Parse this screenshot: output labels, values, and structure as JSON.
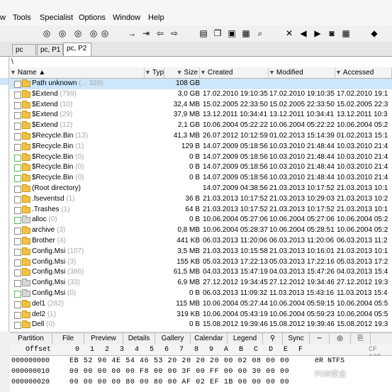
{
  "menu": [
    "w",
    "Tools",
    "Specialist",
    "Options",
    "Window",
    "Help"
  ],
  "toolbar_icons": [
    "binoculars-icon",
    "binoculars-text-icon",
    "binoculars-hex-icon",
    "binoculars-replace-icon",
    "binoculars-find-icon",
    "arrow-right-icon",
    "go-to-icon",
    "back-icon",
    "forward-icon",
    "disk-icon",
    "copy-icon",
    "image-icon",
    "calculator-icon",
    "search-icon",
    "tools-icon",
    "prev-icon",
    "next-icon",
    "camera-icon",
    "grid-icon",
    "book-icon"
  ],
  "tabs": [
    "pc",
    "pc, P1",
    "pc, P2"
  ],
  "path": "\\",
  "columns": {
    "name": "Name",
    "type": "Typ",
    "size": "Size",
    "created": "Created",
    "modified": "Modified",
    "accessed": "Accessed"
  },
  "rows": [
    {
      "name": "Path unknown",
      "count": "(... 328)",
      "size": "108 GB",
      "c": "",
      "m": "",
      "a": "",
      "icon": "folder",
      "sel": true
    },
    {
      "name": "$Extend",
      "count": "(799)",
      "size": "3,0 GB",
      "c": "17.02.2010  19:10:35",
      "m": "17.02.2010  19:10:35",
      "a": "17.02.2010  19:1",
      "icon": "folder",
      "sel": false
    },
    {
      "name": "$Extend",
      "count": "(10)",
      "size": "32,4 MB",
      "c": "15.02.2005  22:33:50",
      "m": "15.02.2005  22:33:50",
      "a": "15.02.2005  22:3",
      "icon": "folder",
      "sel": false
    },
    {
      "name": "$Extend",
      "count": "(29)",
      "size": "37,9 MB",
      "c": "13.12.2011  10:34:41",
      "m": "13.12.2011  10:34:41",
      "a": "13.12.2011  10:3",
      "icon": "folder",
      "sel": false
    },
    {
      "name": "$Extend",
      "count": "(12)",
      "size": "2,1 GB",
      "c": "10.06.2004  05:22:22",
      "m": "10.06.2004  05:22:22",
      "a": "10.06.2004  05:2",
      "icon": "folder",
      "sel": false
    },
    {
      "name": "$Recycle.Bin",
      "count": "(13)",
      "size": "41,3 MB",
      "c": "26.07.2012  10:12:59",
      "m": "01.02.2013  15:14:39",
      "a": "01.02.2013  15:1",
      "icon": "folder",
      "sel": false
    },
    {
      "name": "$Recycle.Bin",
      "count": "(1)",
      "size": "129 B",
      "c": "14.07.2009  05:18:56",
      "m": "10.03.2010  21:48:44",
      "a": "10.03.2010  21:4",
      "icon": "folder",
      "sel": false
    },
    {
      "name": "$Recycle.Bin",
      "count": "(0)",
      "size": "0 B",
      "c": "14.07.2009  05:18:56",
      "m": "10.03.2010  21:48:44",
      "a": "10.03.2010  21:4",
      "icon": "folder",
      "sel": false,
      "green": true
    },
    {
      "name": "$Recycle.Bin",
      "count": "(0)",
      "size": "0 B",
      "c": "14.07.2009  05:18:56",
      "m": "10.03.2010  21:48:44",
      "a": "10.03.2010  21:4",
      "icon": "folder",
      "sel": false,
      "green": true
    },
    {
      "name": "$Recycle.Bin",
      "count": "(0)",
      "size": "0 B",
      "c": "14.07.2009  05:18:56",
      "m": "10.03.2010  21:48:44",
      "a": "10.03.2010  21:4",
      "icon": "folder",
      "sel": false,
      "green": true
    },
    {
      "name": "(Root directory)",
      "count": "",
      "size": "",
      "c": "14.07.2009  04:38:56",
      "m": "21.03.2013  10:17:52",
      "a": "21.03.2013  10:1",
      "icon": "folder",
      "sel": false
    },
    {
      "name": ".fseventsd",
      "count": "(1)",
      "size": "36 B",
      "c": "21.03.2013  10:17:52",
      "m": "21.03.2013  10:29:03",
      "a": "21.03.2013  10:2",
      "icon": "folder",
      "sel": false
    },
    {
      "name": ".Trashes",
      "count": "(1)",
      "size": "64 B",
      "c": "21.03.2013  10:17:52",
      "m": "21.03.2013  10:17:52",
      "a": "21.03.2013  10:1",
      "icon": "folder",
      "sel": false
    },
    {
      "name": "alloc",
      "count": "(0)",
      "size": "0 B",
      "c": "10.06.2004  05:27:06",
      "m": "10.06.2004  05:27:06",
      "a": "10.06.2004  05:2",
      "icon": "folder-gray",
      "sel": false,
      "green": true
    },
    {
      "name": "archive",
      "count": "(3)",
      "size": "0,8 MB",
      "c": "10.06.2004  05:28:37",
      "m": "10.06.2004  05:28:51",
      "a": "10.06.2004  05:2",
      "icon": "folder",
      "sel": false
    },
    {
      "name": "Brother",
      "count": "(4)",
      "size": "441 KB",
      "c": "06.03.2013  11:20:06",
      "m": "06.03.2013  11:20:06",
      "a": "06.03.2013  11:2",
      "icon": "folder",
      "sel": false
    },
    {
      "name": "Config.Msi",
      "count": "(107)",
      "size": "3,5 MB",
      "c": "21.03.2013  10:15:58",
      "m": "21.03.2013  10:16:01",
      "a": "21.03.2013  10:1",
      "icon": "folder",
      "sel": false
    },
    {
      "name": "Config.Msi",
      "count": "(3)",
      "size": "155 KB",
      "c": "05.03.2013  17:22:13",
      "m": "05.03.2013  17:22:16",
      "a": "05.03.2013  17:2",
      "icon": "folder",
      "sel": false
    },
    {
      "name": "Config.Msi",
      "count": "(386)",
      "size": "61,5 MB",
      "c": "04.03.2013  15:47:19",
      "m": "04.03.2013  15:47:26",
      "a": "04.03.2013  15:4",
      "icon": "folder",
      "sel": false
    },
    {
      "name": "Config.Msi",
      "count": "(33)",
      "size": "6,9 MB",
      "c": "27.12.2012  19:34:45",
      "m": "27.12.2012  19:34:46",
      "a": "27.12.2012  19:3",
      "icon": "folder-gray",
      "sel": false
    },
    {
      "name": "Config.Msi",
      "count": "(0)",
      "size": "0 B",
      "c": "06.03.2013  11:09:32",
      "m": "11.03.2013  15:43:16",
      "a": "11.03.2013  15:4",
      "icon": "folder-gray",
      "sel": false,
      "green": true
    },
    {
      "name": "del1",
      "count": "(282)",
      "size": "115 MB",
      "c": "10.06.2004  05:27:44",
      "m": "10.06.2004  05:59:15",
      "a": "10.06.2004  05:5",
      "icon": "folder",
      "sel": false
    },
    {
      "name": "del2",
      "count": "(1)",
      "size": "319 KB",
      "c": "10.06.2004  05:43:19",
      "m": "10.06.2004  05:59:23",
      "a": "10.06.2004  05:5",
      "icon": "folder",
      "sel": false
    },
    {
      "name": "Dell",
      "count": "(0)",
      "size": "0 B",
      "c": "15.08.2012  19:39:46",
      "m": "15.08.2012  19:39:46",
      "a": "15.08.2012  19:3",
      "icon": "folder",
      "sel": false
    }
  ],
  "bottom_tabs": [
    "Partition",
    "File",
    "Preview",
    "Details",
    "Gallery",
    "Calendar",
    "Legend",
    "Sync"
  ],
  "hex_header": {
    "offset": "Offset",
    "cols": [
      "0",
      "1",
      "2",
      "3",
      "4",
      "5",
      "6",
      "7",
      "8",
      "9",
      "A",
      "B",
      "C",
      "D",
      "E",
      "F"
    ],
    "right": "CF 125"
  },
  "hex_rows": [
    {
      "off": "000000000",
      "bytes": "EB 52 90 4E 54 46 53 20  20 20 20 00 02 08 00 00",
      "txt": "ëR NTFS"
    },
    {
      "off": "000000010",
      "bytes": "00 00 00 00 00 F8 00 00  3F 00 FF 00 00 30 00 00",
      "txt": ""
    },
    {
      "off": "000000020",
      "bytes": "00 00 00 00 80 00 80 00  AF 02 EF 1B 00 00 00 00",
      "txt": ""
    }
  ],
  "watermark": "FOB安全"
}
